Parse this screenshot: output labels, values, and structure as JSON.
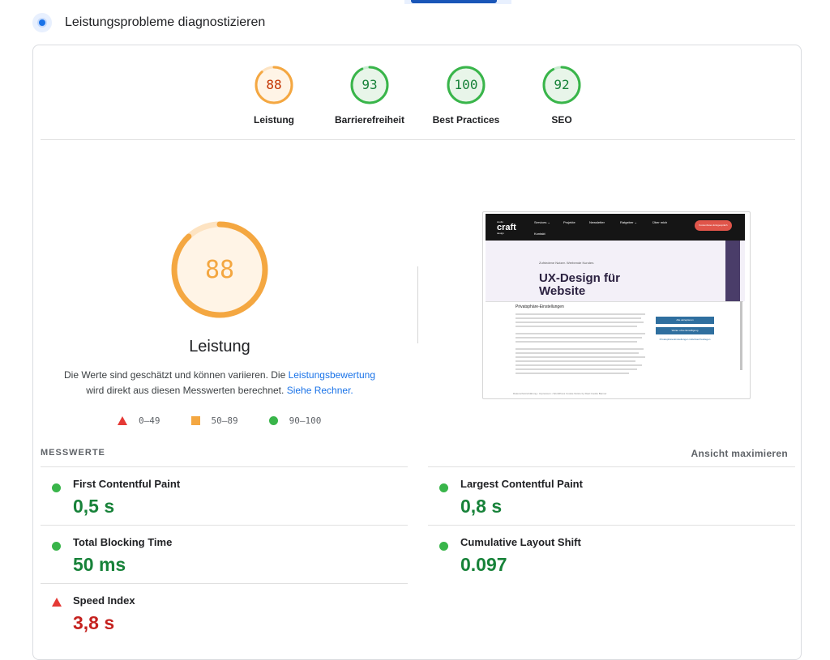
{
  "header": {
    "title": "Leistungsprobleme diagnostizieren",
    "icon": "lighthouse-dot-icon"
  },
  "categories": [
    {
      "label": "Leistung",
      "score": "88",
      "status": "average",
      "value": 88
    },
    {
      "label": "Barrierefreiheit",
      "score": "93",
      "status": "pass",
      "value": 93
    },
    {
      "label": "Best Practices",
      "score": "100",
      "status": "pass",
      "value": 100
    },
    {
      "label": "SEO",
      "score": "92",
      "status": "pass",
      "value": 92
    }
  ],
  "main": {
    "score": "88",
    "score_value": 88,
    "title": "Leistung",
    "desc_pre": "Die Werte sind geschätzt und können variieren. Die ",
    "desc_link1": "Leistungsbewertung",
    "desc_mid": "wird direkt aus diesen Messwerten berechnet. ",
    "desc_link2": "Siehe Rechner."
  },
  "legend": [
    {
      "shape": "triangle",
      "range": "0–49",
      "color": "#e53935"
    },
    {
      "shape": "square",
      "range": "50–89",
      "color": "#f4a741"
    },
    {
      "shape": "circle",
      "range": "90–100",
      "color": "#39b54a"
    }
  ],
  "screenshot": {
    "logo_top": "studio",
    "logo": "craft",
    "logo_sub": "design",
    "nav": [
      "Services ⌄",
      "Projekte",
      "Newsletter",
      "Ratgeber ⌄",
      "Über mich",
      "Kontakt"
    ],
    "cta": "Kostenfreies Erstgespräch",
    "sub": "Zufriedene Nutzer. Werbende Kunden.",
    "headline_1": "UX-Design für",
    "headline_2": "Website",
    "modal_title": "Privatsphäre-Einstellungen",
    "btn_accept": "Alle akzeptieren",
    "btn_continue": "Weiter ohne Einwilligung",
    "link_individual": "Privatsphäre-Einstellungen individuell festlegen",
    "footer": "Datenschutzerklärung • Impressum • WordPress Cookie Notice by Real Cookie Banner"
  },
  "metrics": {
    "heading": "MESSWERTE",
    "maximize": "Ansicht maximieren",
    "items": [
      {
        "name": "First Contentful Paint",
        "value": "0,5 s",
        "status": "pass"
      },
      {
        "name": "Largest Contentful Paint",
        "value": "0,8 s",
        "status": "pass"
      },
      {
        "name": "Total Blocking Time",
        "value": "50 ms",
        "status": "pass"
      },
      {
        "name": "Cumulative Layout Shift",
        "value": "0.097",
        "status": "pass"
      },
      {
        "name": "Speed Index",
        "value": "3,8 s",
        "status": "fail"
      }
    ]
  },
  "colors": {
    "average": "#f4a741",
    "average_bg": "#fff4e6",
    "average_text": "#c33300",
    "pass": "#39b54a",
    "pass_bg": "#e8f5e9",
    "pass_text": "#178239",
    "fail": "#e53935"
  }
}
